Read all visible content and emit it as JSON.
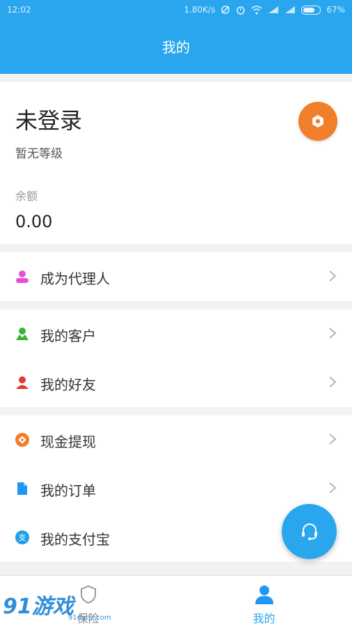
{
  "status_bar": {
    "time": "12:02",
    "network_speed": "1.80K/s",
    "battery": "67%",
    "icons": [
      "sync-off-icon",
      "alarm-icon",
      "wifi-icon",
      "signal-icon",
      "signal-icon",
      "battery-icon"
    ]
  },
  "header": {
    "title": "我的"
  },
  "profile": {
    "username": "未登录",
    "level": "暂无等级",
    "balance_label": "余额",
    "balance_value": "0.00"
  },
  "menu": {
    "group1": [
      {
        "label": "成为代理人",
        "icon": "agent-icon",
        "color": "#e84fd8"
      }
    ],
    "group2": [
      {
        "label": "我的客户",
        "icon": "customer-icon",
        "color": "#3bb233"
      },
      {
        "label": "我的好友",
        "icon": "friend-icon",
        "color": "#e8332f"
      }
    ],
    "group3": [
      {
        "label": "现金提现",
        "icon": "cash-icon",
        "color": "#f07e2a"
      },
      {
        "label": "我的订单",
        "icon": "order-icon",
        "color": "#2196f3"
      },
      {
        "label": "我的支付宝",
        "icon": "alipay-icon",
        "color": "#1ea0e8"
      }
    ]
  },
  "tab_bar": {
    "tabs": [
      {
        "label": "保险",
        "icon": "shield-icon",
        "active": false
      },
      {
        "label": "我的",
        "icon": "person-icon",
        "active": true
      }
    ]
  },
  "watermark": {
    "text": "91游戏",
    "url": "91danji.com"
  },
  "colors": {
    "primary": "#29a6ee",
    "accent": "#f07e2a"
  }
}
